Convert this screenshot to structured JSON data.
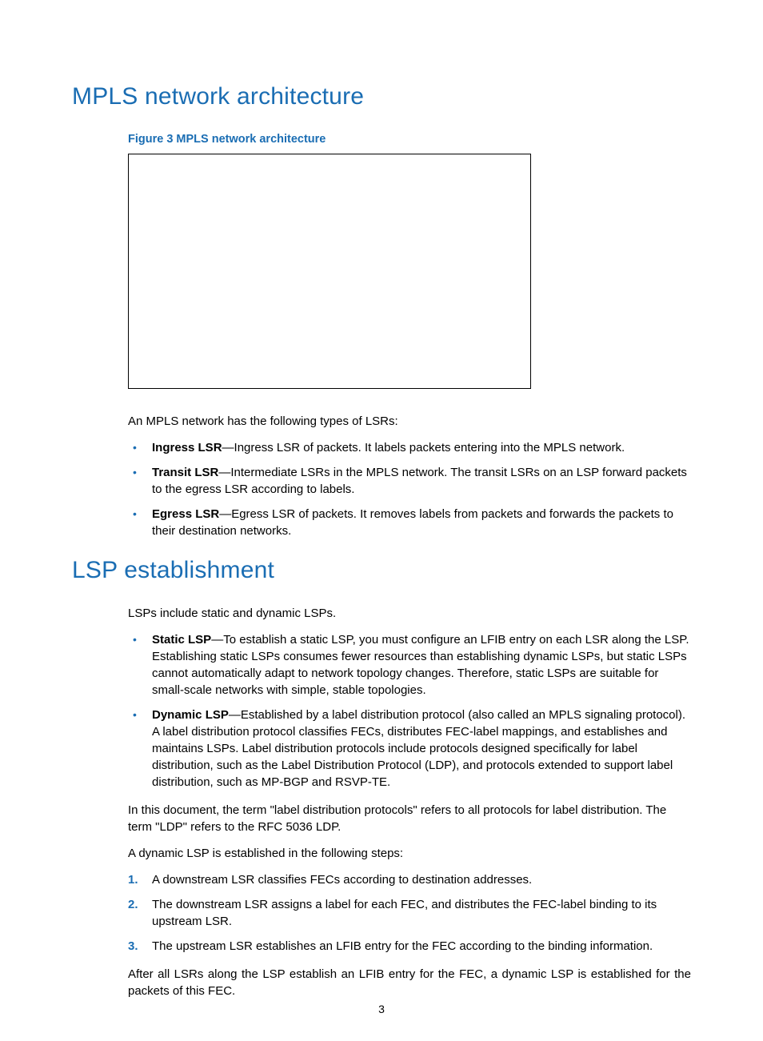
{
  "section1": {
    "title": "MPLS network architecture",
    "figure_caption": "Figure 3 MPLS network architecture",
    "intro": "An MPLS network has the following types of LSRs:",
    "bullets": [
      {
        "term": "Ingress LSR",
        "desc": "—Ingress LSR of packets. It labels packets entering into the MPLS network."
      },
      {
        "term": "Transit LSR",
        "desc": "—Intermediate LSRs in the MPLS network. The transit LSRs on an LSP forward packets to the egress LSR according to labels."
      },
      {
        "term": "Egress LSR",
        "desc": "—Egress LSR of packets. It removes labels from packets and forwards the packets to their destination networks."
      }
    ]
  },
  "section2": {
    "title": "LSP establishment",
    "intro": "LSPs include static and dynamic LSPs.",
    "bullets": [
      {
        "term": "Static LSP",
        "desc": "—To establish a static LSP, you must configure an LFIB entry on each LSR along the LSP. Establishing static LSPs consumes fewer resources than establishing dynamic LSPs, but static LSPs cannot automatically adapt to network topology changes. Therefore, static LSPs are suitable for small-scale networks with simple, stable topologies."
      },
      {
        "term": "Dynamic LSP",
        "desc": "—Established by a label distribution protocol (also called an MPLS signaling protocol). A label distribution protocol classifies FECs, distributes FEC-label mappings, and establishes and maintains LSPs. Label distribution protocols include protocols designed specifically for label distribution, such as the Label Distribution Protocol (LDP), and protocols extended to support label distribution, such as MP-BGP and RSVP-TE."
      }
    ],
    "para1": "In this document, the term \"label distribution protocols\" refers to all protocols for label distribution. The term \"LDP\" refers to the RFC 5036 LDP.",
    "para2": "A dynamic LSP is established in the following steps:",
    "steps": [
      "A downstream LSR classifies FECs according to destination addresses.",
      "The downstream LSR assigns a label for each FEC, and distributes the FEC-label binding to its upstream LSR.",
      "The upstream LSR establishes an LFIB entry for the FEC according to the binding information."
    ],
    "para3": "After all LSRs along the LSP establish an LFIB entry for the FEC, a dynamic LSP is established for the packets of this FEC."
  },
  "page_number": "3"
}
